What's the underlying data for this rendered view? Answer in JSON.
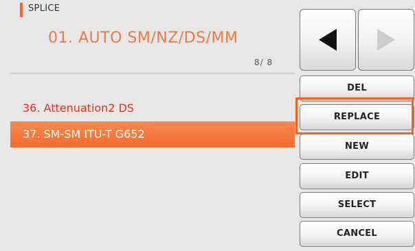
{
  "header": {
    "section_title": "SPLICE",
    "mode_title": "01. AUTO SM/NZ/DS/MM",
    "page_counter": "8/ 8"
  },
  "list": {
    "items": [
      {
        "label": "36. Attenuation2 DS",
        "selected": false
      },
      {
        "label": "37. SM-SM ITU-T G652",
        "selected": true
      }
    ]
  },
  "nav": {
    "prev_icon": "triangle-left-icon",
    "next_icon": "triangle-right-icon",
    "prev_enabled": true,
    "next_enabled": false
  },
  "buttons": {
    "del": "DEL",
    "replace": "REPLACE",
    "new": "NEW",
    "edit": "EDIT",
    "select": "SELECT",
    "cancel": "CANCEL"
  },
  "colors": {
    "accent": "#f46a2a",
    "list_text": "#e2341f",
    "selected_bg": "#f46c2e",
    "highlight": "#f2641e"
  }
}
